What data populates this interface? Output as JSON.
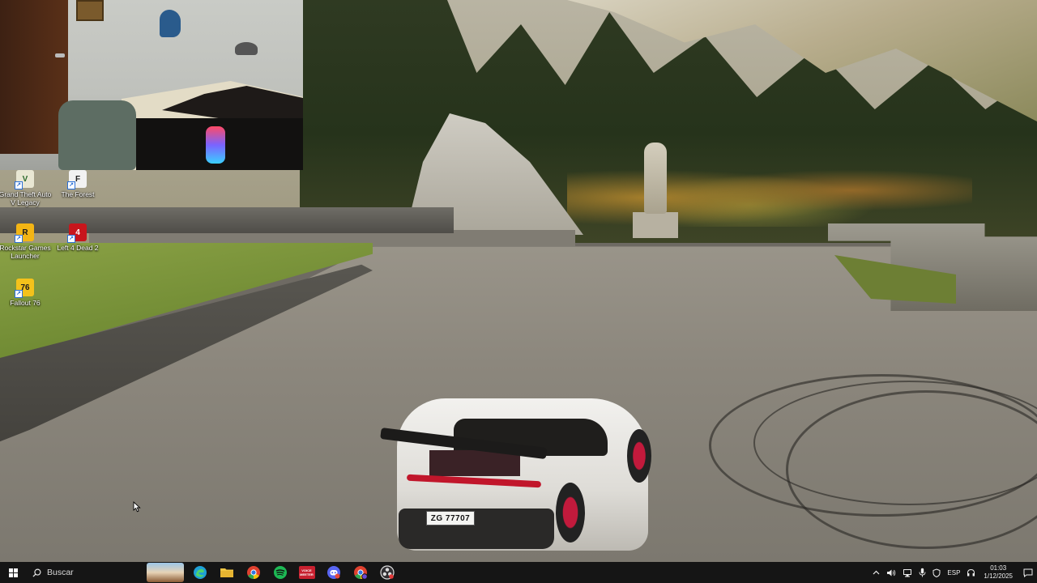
{
  "wallpaper": {
    "car_plate": "ZG 77707"
  },
  "desktop_icons": [
    {
      "label": "Grand Theft Auto V Legacy",
      "icon": "gta-v-icon",
      "badge": "V"
    },
    {
      "label": "The Forest",
      "icon": "the-forest-icon",
      "badge": "F"
    },
    {
      "label": "Rockstar Games Launcher",
      "icon": "rockstar-icon",
      "badge": "R"
    },
    {
      "label": "Left 4 Dead 2",
      "icon": "left4dead2-icon",
      "badge": "4"
    },
    {
      "label": "Fallout 76",
      "icon": "fallout76-icon",
      "badge": "76"
    }
  ],
  "taskbar": {
    "search_label": "Buscar",
    "apps": [
      {
        "name": "news-weather",
        "color": "#c9a06b"
      },
      {
        "name": "edge",
        "color": "#1fa0d6"
      },
      {
        "name": "file-explorer",
        "color": "#f2c744"
      },
      {
        "name": "chrome",
        "color": "#e0412f"
      },
      {
        "name": "spotify",
        "color": "#1db954"
      },
      {
        "name": "voicemod",
        "color": "#d32a3a"
      },
      {
        "name": "discord-mod",
        "color": "#5865f2"
      },
      {
        "name": "chrome-profile",
        "color": "#e0412f"
      },
      {
        "name": "obs-studio",
        "color": "#302e31"
      }
    ],
    "voicemod_label": "VOICE\nMEETER",
    "tray": {
      "language": "ESP",
      "time": "01:03",
      "date": "1/12/2025"
    }
  }
}
